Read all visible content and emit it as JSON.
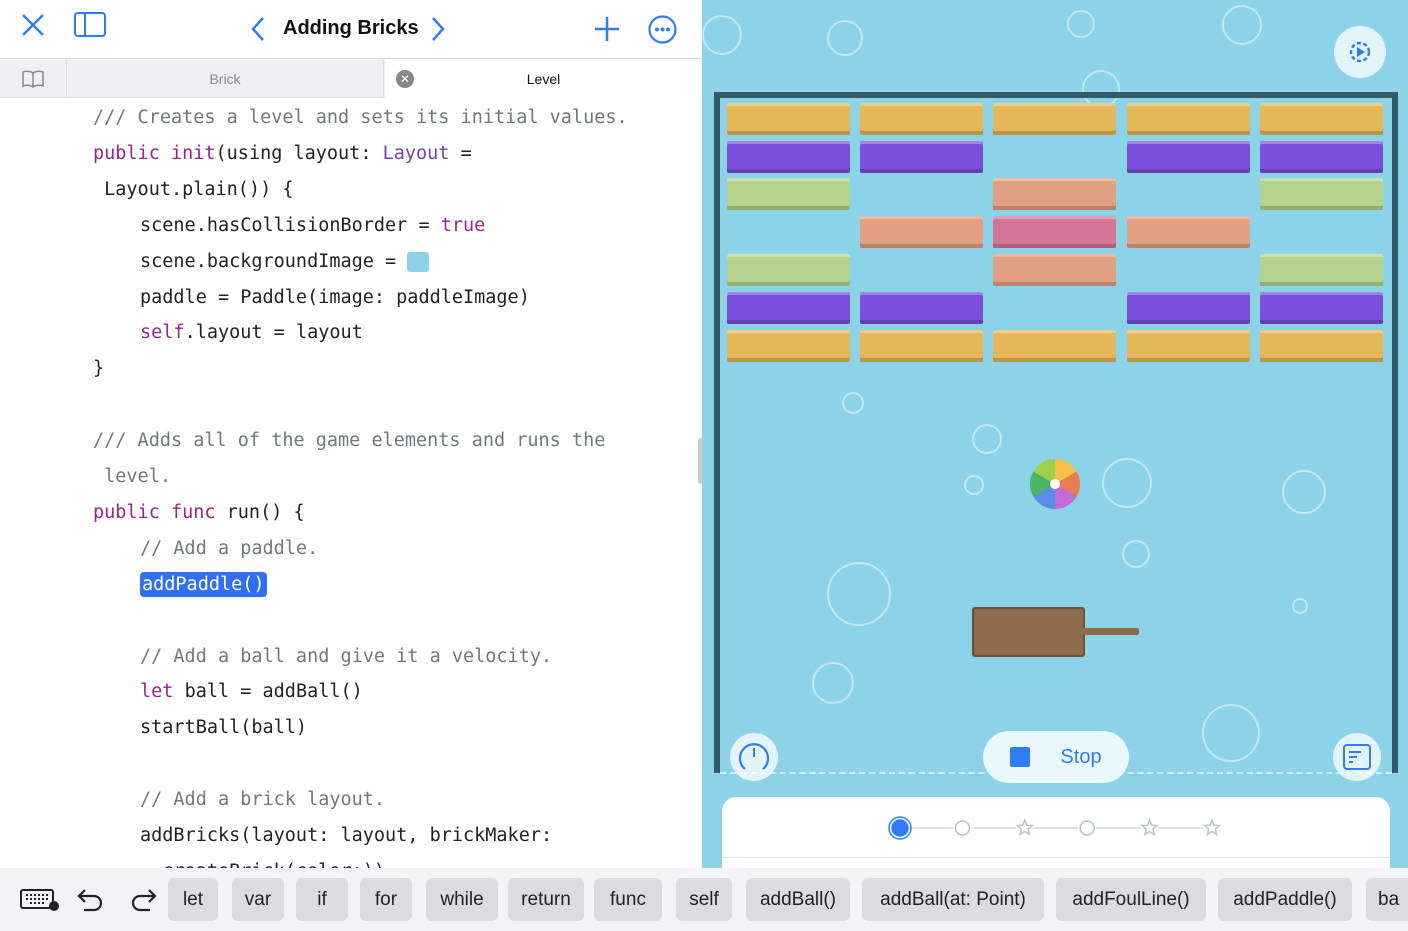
{
  "nav": {
    "title": "Adding Bricks"
  },
  "tabs": [
    {
      "label": "Brick"
    },
    {
      "label": "Level"
    }
  ],
  "code": [
    {
      "indent": 0,
      "tokens": [
        [
          "c",
          "/// Creates a level and sets its initial values."
        ]
      ]
    },
    {
      "indent": 0,
      "tokens": [
        [
          "k",
          "public "
        ],
        [
          "k",
          "init"
        ],
        [
          "",
          "(using layout: "
        ],
        [
          "t",
          "Layout"
        ],
        [
          "",
          " ="
        ]
      ]
    },
    {
      "indent": 0,
      "tokens": [
        [
          "",
          " Layout.plain()) {"
        ]
      ]
    },
    {
      "indent": 1,
      "tokens": [
        [
          "",
          "scene.hasCollisionBorder = "
        ],
        [
          "k",
          "true"
        ]
      ]
    },
    {
      "indent": 1,
      "tokens": [
        [
          "",
          "scene.backgroundImage = "
        ],
        [
          "swatch",
          ""
        ]
      ]
    },
    {
      "indent": 1,
      "tokens": [
        [
          "",
          "paddle = Paddle(image: paddleImage)"
        ]
      ]
    },
    {
      "indent": 1,
      "tokens": [
        [
          "k",
          "self"
        ],
        [
          "",
          ".layout = layout"
        ]
      ]
    },
    {
      "indent": 0,
      "tokens": [
        [
          "",
          "}"
        ]
      ]
    },
    {
      "indent": 0,
      "tokens": []
    },
    {
      "indent": 0,
      "tokens": [
        [
          "c",
          "/// Adds all of the game elements and runs the"
        ]
      ]
    },
    {
      "indent": 0,
      "tokens": [
        [
          "c",
          " level."
        ]
      ]
    },
    {
      "indent": 0,
      "tokens": [
        [
          "k",
          "public func "
        ],
        [
          "",
          "run() {"
        ]
      ]
    },
    {
      "indent": 1,
      "tokens": [
        [
          "c",
          "// Add a paddle."
        ]
      ]
    },
    {
      "indent": 1,
      "tokens": [
        [
          "sel",
          "addPaddle()"
        ]
      ]
    },
    {
      "indent": 0,
      "tokens": []
    },
    {
      "indent": 1,
      "tokens": [
        [
          "c",
          "// Add a ball and give it a velocity."
        ]
      ]
    },
    {
      "indent": 1,
      "tokens": [
        [
          "k",
          "let "
        ],
        [
          "",
          "ball = addBall()"
        ]
      ]
    },
    {
      "indent": 1,
      "tokens": [
        [
          "",
          "startBall(ball)"
        ]
      ]
    },
    {
      "indent": 0,
      "tokens": []
    },
    {
      "indent": 1,
      "tokens": [
        [
          "c",
          "// Add a brick layout."
        ]
      ]
    },
    {
      "indent": 1,
      "tokens": [
        [
          "",
          "addBricks(layout: layout, brickMaker:"
        ]
      ]
    },
    {
      "indent": 1,
      "tokens": [
        [
          "",
          "  createBrick(color:))"
        ]
      ]
    }
  ],
  "game": {
    "colors": {
      "Y": "#e4b85a",
      "P": "#7b4fdc",
      "G": "#b6d28f",
      "O": "#e2a083",
      "M": "#d47598",
      "bg": "#8dd3e8",
      "accent": "#2f7cf6"
    },
    "bricks": [
      "YYYYY",
      "PP.PP",
      "G.O.G",
      ".OMO.",
      "G.O.G",
      "PP.PP",
      "YYYYY"
    ],
    "stop_label": "Stop",
    "progress": {
      "steps": [
        "circle",
        "circle",
        "star",
        "circle",
        "star",
        "star"
      ],
      "current": 0
    }
  },
  "toolbar": {
    "chips": [
      "let",
      "var",
      "if",
      "for",
      "while",
      "return",
      "func",
      "self",
      "addBall()",
      "addBall(at: Point)",
      "addFoulLine()",
      "addPaddle()",
      "ba"
    ]
  }
}
